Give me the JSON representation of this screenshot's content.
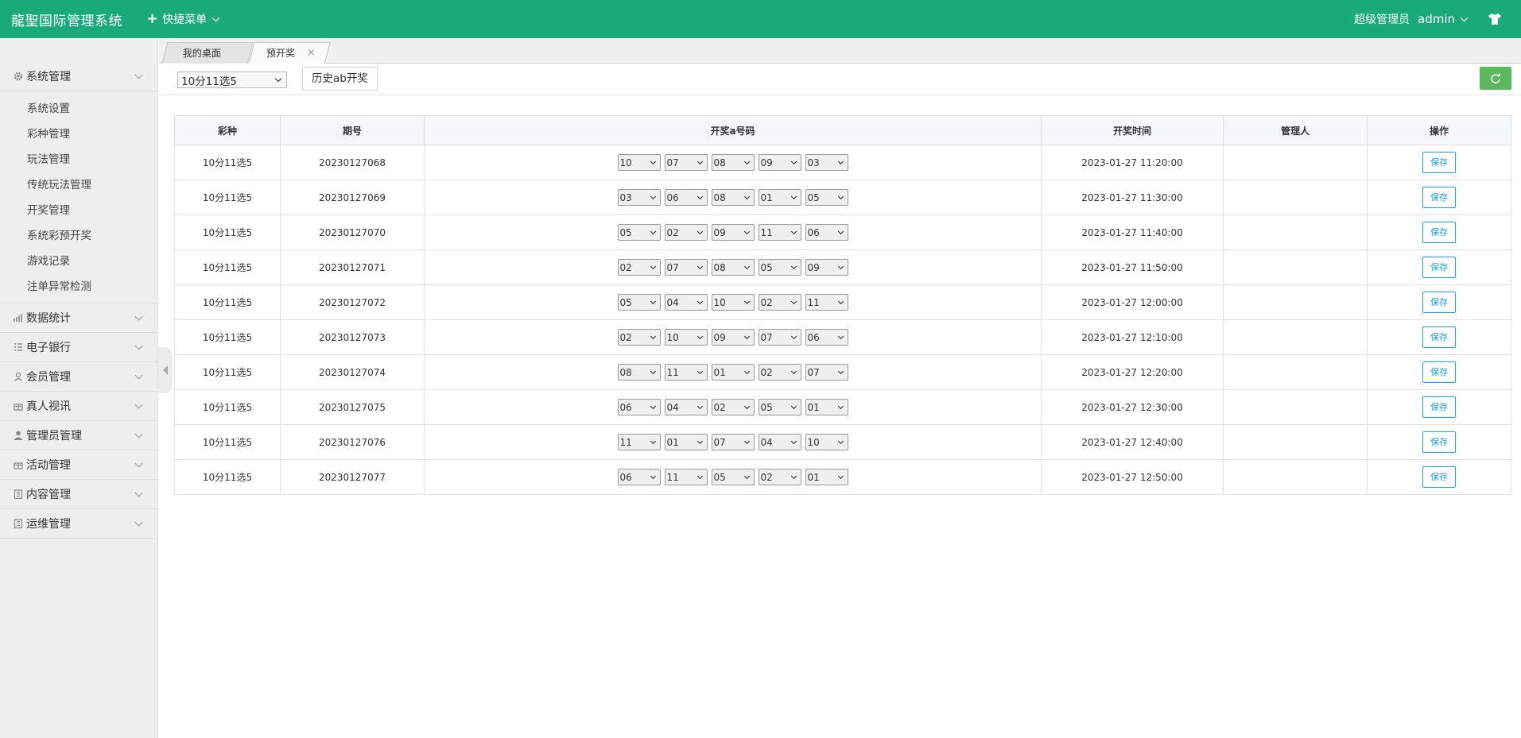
{
  "app": {
    "brand": "龍聖国际管理系统",
    "quick_menu": "快捷菜单",
    "role": "超级管理员",
    "user": "admin"
  },
  "sidebar": {
    "groups": [
      {
        "label": "系统管理",
        "icon": "gear-icon",
        "expanded": true,
        "items": [
          "系统设置",
          "彩种管理",
          "玩法管理",
          "传统玩法管理",
          "开奖管理",
          "系统彩预开奖",
          "游戏记录",
          "注单异常检测"
        ]
      },
      {
        "label": "数据统计",
        "icon": "bar-chart-icon"
      },
      {
        "label": "电子银行",
        "icon": "list-icon"
      },
      {
        "label": "会员管理",
        "icon": "user-outline-icon"
      },
      {
        "label": "真人视讯",
        "icon": "gift-icon"
      },
      {
        "label": "管理员管理",
        "icon": "user-solid-icon"
      },
      {
        "label": "活动管理",
        "icon": "gift-icon"
      },
      {
        "label": "内容管理",
        "icon": "building-icon"
      },
      {
        "label": "运维管理",
        "icon": "building-icon"
      }
    ]
  },
  "tabs": [
    {
      "label": "我的桌面"
    },
    {
      "label": "预开奖",
      "active": true,
      "close": "×"
    }
  ],
  "toolbar": {
    "lottery_select": "10分11选5",
    "history_button": "历史ab开奖"
  },
  "table": {
    "headers": [
      "彩种",
      "期号",
      "开奖a号码",
      "开奖时间",
      "管理人",
      "操作"
    ],
    "save_label": "保存",
    "rows": [
      {
        "lottery": "10分11选5",
        "issue": "20230127068",
        "numbers": [
          "10",
          "07",
          "08",
          "09",
          "03"
        ],
        "time": "2023-01-27 11:20:00",
        "manager": ""
      },
      {
        "lottery": "10分11选5",
        "issue": "20230127069",
        "numbers": [
          "03",
          "06",
          "08",
          "01",
          "05"
        ],
        "time": "2023-01-27 11:30:00",
        "manager": ""
      },
      {
        "lottery": "10分11选5",
        "issue": "20230127070",
        "numbers": [
          "05",
          "02",
          "09",
          "11",
          "06"
        ],
        "time": "2023-01-27 11:40:00",
        "manager": ""
      },
      {
        "lottery": "10分11选5",
        "issue": "20230127071",
        "numbers": [
          "02",
          "07",
          "08",
          "05",
          "09"
        ],
        "time": "2023-01-27 11:50:00",
        "manager": ""
      },
      {
        "lottery": "10分11选5",
        "issue": "20230127072",
        "numbers": [
          "05",
          "04",
          "10",
          "02",
          "11"
        ],
        "time": "2023-01-27 12:00:00",
        "manager": ""
      },
      {
        "lottery": "10分11选5",
        "issue": "20230127073",
        "numbers": [
          "02",
          "10",
          "09",
          "07",
          "06"
        ],
        "time": "2023-01-27 12:10:00",
        "manager": ""
      },
      {
        "lottery": "10分11选5",
        "issue": "20230127074",
        "numbers": [
          "08",
          "11",
          "01",
          "02",
          "07"
        ],
        "time": "2023-01-27 12:20:00",
        "manager": ""
      },
      {
        "lottery": "10分11选5",
        "issue": "20230127075",
        "numbers": [
          "06",
          "04",
          "02",
          "05",
          "01"
        ],
        "time": "2023-01-27 12:30:00",
        "manager": ""
      },
      {
        "lottery": "10分11选5",
        "issue": "20230127076",
        "numbers": [
          "11",
          "01",
          "07",
          "04",
          "10"
        ],
        "time": "2023-01-27 12:40:00",
        "manager": ""
      },
      {
        "lottery": "10分11选5",
        "issue": "20230127077",
        "numbers": [
          "06",
          "11",
          "05",
          "02",
          "01"
        ],
        "time": "2023-01-27 12:50:00",
        "manager": ""
      }
    ]
  },
  "colors": {
    "topbar": "#1aaa7a",
    "save_button": "#1e9fff",
    "refresh_button": "#5cb85c"
  }
}
